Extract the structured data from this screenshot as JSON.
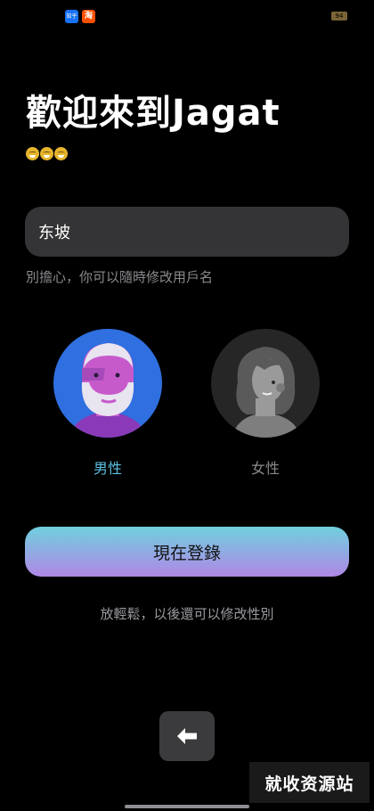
{
  "status_bar": {
    "app1": "知乎",
    "app2": "淘",
    "battery": "94"
  },
  "header": {
    "title": "歡迎來到Jagat"
  },
  "name_input": {
    "value": "东坡",
    "hint": "別擔心，你可以隨時修改用戶名"
  },
  "gender": {
    "selected": "male",
    "options": [
      {
        "id": "male",
        "label": "男性"
      },
      {
        "id": "female",
        "label": "女性"
      }
    ]
  },
  "actions": {
    "login_label": "現在登錄",
    "footer_note": "放輕鬆，以後還可以修改性別"
  },
  "watermark": "就收资源站",
  "colors": {
    "accent_start": "#6fd0de",
    "accent_end": "#b087e6",
    "selected_label": "#5bc0e0"
  }
}
